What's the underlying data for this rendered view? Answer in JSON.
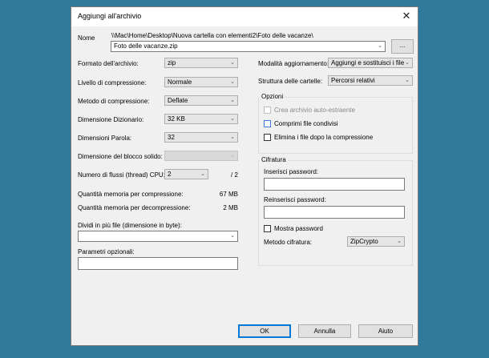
{
  "window": {
    "title": "Aggiungi all'archivio",
    "close_glyph": "✕"
  },
  "name": {
    "label": "Nome",
    "path": "\\\\Mac\\Home\\Desktop\\Nuova cartella con elementi2\\Foto delle vacanze\\",
    "value": "Foto delle vacanze.zip",
    "browse_label": "..."
  },
  "left": {
    "format_label": "Formato dell'archivio:",
    "format_value": "zip",
    "level_label": "Livello di compressione:",
    "level_value": "Normale",
    "method_label": "Metodo di compressione:",
    "method_value": "Deflate",
    "dict_label": "Dimensione Dizionario:",
    "dict_value": "32 KB",
    "word_label": "Dimensioni Parola:",
    "word_value": "32",
    "block_label": "Dimensione del blocco solido:",
    "block_value": "",
    "threads_label": "Numero di flussi (thread) CPU:",
    "threads_value": "2",
    "threads_max": "/ 2",
    "mem_comp_label": "Quantità memoria per compressione:",
    "mem_comp_value": "67 MB",
    "mem_decomp_label": "Quantità memoria per decompressione:",
    "mem_decomp_value": "2 MB",
    "split_label": "Dividi in più file (dimensione in byte):",
    "split_value": "",
    "params_label": "Parametri opzionali:",
    "params_value": ""
  },
  "right": {
    "update_label": "Modalità aggiornamento:",
    "update_value": "Aggiungi e sostituisci i file",
    "paths_label": "Struttura delle cartelle:",
    "paths_value": "Percorsi relativi",
    "options": {
      "title": "Opzioni",
      "sfx_label": "Crea archivio auto-estraente",
      "shared_label": "Comprimi file condivisi",
      "delete_label": "Elimina i file dopo la compressione"
    },
    "encryption": {
      "title": "Cifratura",
      "password_label": "Inserisci password:",
      "reenter_label": "Reinserisci password:",
      "show_label": "Mostra password",
      "method_label": "Metodo cifratura:",
      "method_value": "ZipCrypto"
    }
  },
  "buttons": {
    "ok": "OK",
    "cancel": "Annulla",
    "help": "Aiuto"
  },
  "icons": {
    "dropdown": "chevron-down-icon",
    "close": "close-icon"
  },
  "colors": {
    "desktop": "#2f7a9b",
    "dialog": "#f0f0f0",
    "default_button_border": "#0078d7"
  }
}
